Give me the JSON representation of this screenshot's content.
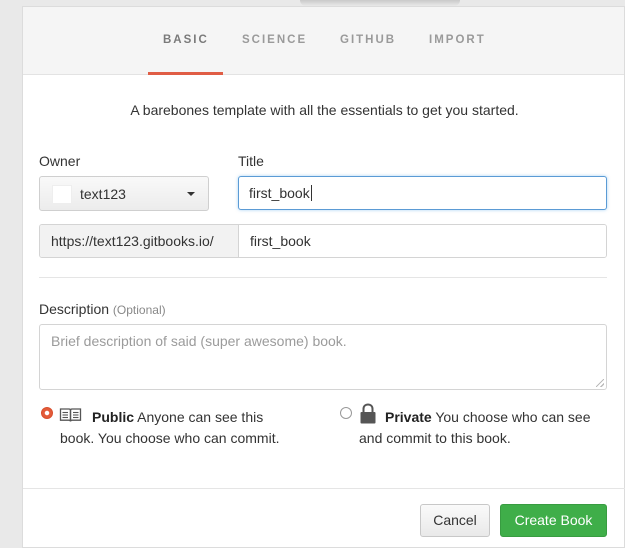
{
  "tabs": [
    {
      "label": "BASIC",
      "active": true
    },
    {
      "label": "SCIENCE",
      "active": false
    },
    {
      "label": "GITHUB",
      "active": false
    },
    {
      "label": "IMPORT",
      "active": false
    }
  ],
  "intro": "A barebones template with all the essentials to get you started.",
  "owner": {
    "label": "Owner",
    "value": "text123"
  },
  "title": {
    "label": "Title",
    "value": "first_book"
  },
  "url": {
    "prefix": "https://text123.gitbooks.io/",
    "slug": "first_book"
  },
  "description": {
    "label": "Description",
    "optional": "(Optional)",
    "placeholder": "Brief description of said (super awesome) book."
  },
  "visibility": {
    "selected": "public",
    "public": {
      "title": "Public",
      "text_a": "Anyone can see this",
      "text_b": "book. You choose who can commit.",
      "icon": "book-icon"
    },
    "private": {
      "title": "Private",
      "text_a": "You choose who can see",
      "text_b": "and commit to this book.",
      "icon": "lock-icon"
    }
  },
  "buttons": {
    "cancel": "Cancel",
    "create": "Create Book"
  },
  "colors": {
    "accent": "#e05d45",
    "primary_button": "#3fae49",
    "focus": "#5b9bd5"
  }
}
